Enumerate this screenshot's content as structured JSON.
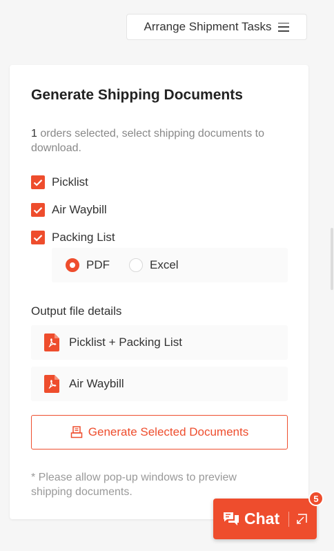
{
  "header": {
    "arrange_button_label": "Arrange Shipment Tasks"
  },
  "card": {
    "title": "Generate Shipping Documents",
    "selected_count": "1",
    "description_rest": " orders selected, select shipping documents to download.",
    "documents": [
      {
        "label": "Picklist",
        "checked": true
      },
      {
        "label": "Air Waybill",
        "checked": true
      },
      {
        "label": "Packing List",
        "checked": true
      }
    ],
    "format_options": [
      {
        "label": "PDF",
        "selected": true
      },
      {
        "label": "Excel",
        "selected": false
      }
    ],
    "output_label": "Output file details",
    "output_files": [
      {
        "label": "Picklist + Packing List",
        "icon": "pdf-file-icon"
      },
      {
        "label": "Air Waybill",
        "icon": "pdf-file-icon"
      }
    ],
    "generate_button_label": "Generate Selected Documents",
    "note": "* Please allow pop-up windows to preview shipping documents."
  },
  "chat": {
    "label": "Chat",
    "badge_count": "5"
  },
  "colors": {
    "accent": "#ee4d2d",
    "background": "#f6f6f6"
  }
}
